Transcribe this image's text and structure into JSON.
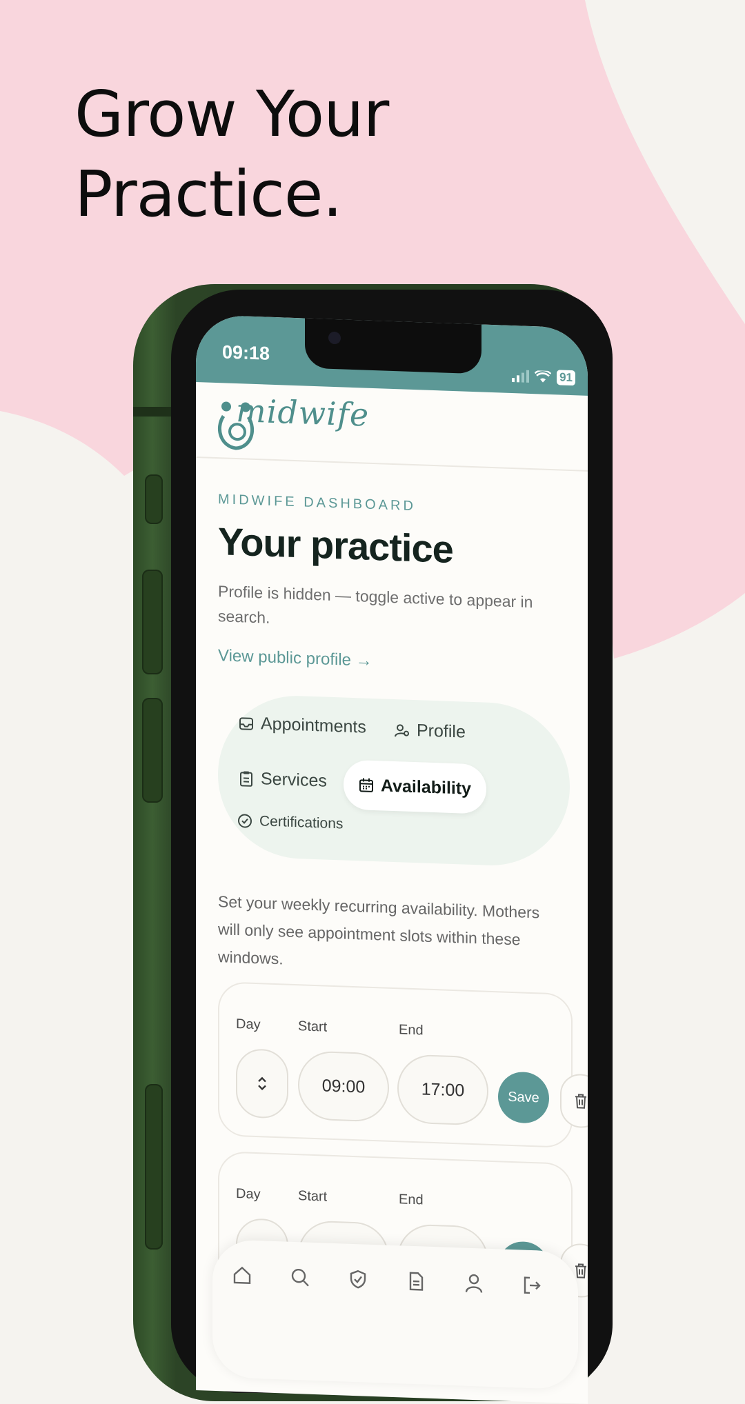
{
  "headline": {
    "line1": "Grow Your",
    "line2": "Practice."
  },
  "colors": {
    "accent": "#5c9896",
    "background_pink": "#f9d6dd",
    "background_cream": "#f5f3ef",
    "phone_frame": "#2c4426"
  },
  "status_bar": {
    "time": "09:18",
    "battery": "91"
  },
  "app": {
    "logo_text": "midwife"
  },
  "dashboard": {
    "eyebrow": "MIDWIFE DASHBOARD",
    "title": "Your practice",
    "subtitle": "Profile is hidden — toggle active to appear in search.",
    "view_profile_link": "View public profile →"
  },
  "tabs": [
    {
      "label": "Appointments",
      "icon": "inbox-icon",
      "active": false
    },
    {
      "label": "Profile",
      "icon": "user-gear-icon",
      "active": false
    },
    {
      "label": "Services",
      "icon": "clipboard-icon",
      "active": false
    },
    {
      "label": "Availability",
      "icon": "calendar-icon",
      "active": true
    },
    {
      "label": "Certifications",
      "icon": "badge-check-icon",
      "active": false
    }
  ],
  "availability": {
    "description": "Set your weekly recurring availability. Mothers will only see appointment slots within these windows.",
    "labels": {
      "day": "Day",
      "start": "Start",
      "end": "End",
      "save": "Save"
    },
    "slots": [
      {
        "day": "",
        "start": "09:00",
        "end": "17:00"
      },
      {
        "day": "",
        "start": "",
        "end": ""
      }
    ]
  },
  "bottom_nav": [
    "home-icon",
    "search-icon",
    "shield-check-icon",
    "document-icon",
    "user-icon",
    "logout-icon"
  ]
}
